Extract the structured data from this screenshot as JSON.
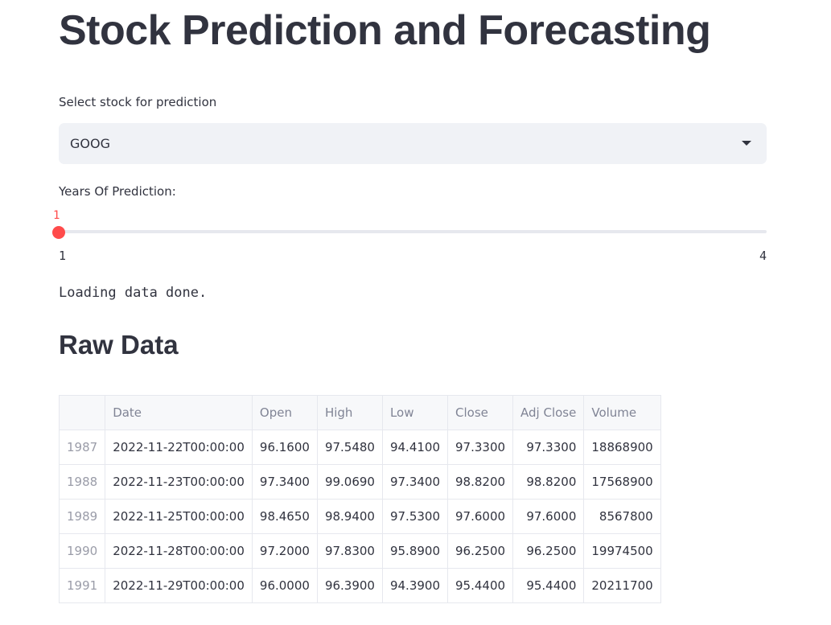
{
  "page": {
    "title": "Stock Prediction and Forecasting"
  },
  "stock_select": {
    "label": "Select stock for prediction",
    "value": "GOOG"
  },
  "years_slider": {
    "label": "Years Of Prediction:",
    "value": "1",
    "min": "1",
    "max": "4"
  },
  "status": "Loading data done.",
  "raw_data": {
    "heading": "Raw Data",
    "columns": [
      "",
      "Date",
      "Open",
      "High",
      "Low",
      "Close",
      "Adj Close",
      "Volume"
    ],
    "rows": [
      [
        "1987",
        "2022-11-22T00:00:00",
        "96.1600",
        "97.5480",
        "94.4100",
        "97.3300",
        "97.3300",
        "18868900"
      ],
      [
        "1988",
        "2022-11-23T00:00:00",
        "97.3400",
        "99.0690",
        "97.3400",
        "98.8200",
        "98.8200",
        "17568900"
      ],
      [
        "1989",
        "2022-11-25T00:00:00",
        "98.4650",
        "98.9400",
        "97.5300",
        "97.6000",
        "97.6000",
        "8567800"
      ],
      [
        "1990",
        "2022-11-28T00:00:00",
        "97.2000",
        "97.8300",
        "95.8900",
        "96.2500",
        "96.2500",
        "19974500"
      ],
      [
        "1991",
        "2022-11-29T00:00:00",
        "96.0000",
        "96.3900",
        "94.3900",
        "95.4400",
        "95.4400",
        "20211700"
      ]
    ]
  },
  "colors": {
    "accent": "#ff4b4b",
    "text": "#31333f",
    "select_bg": "#f0f2f6"
  }
}
